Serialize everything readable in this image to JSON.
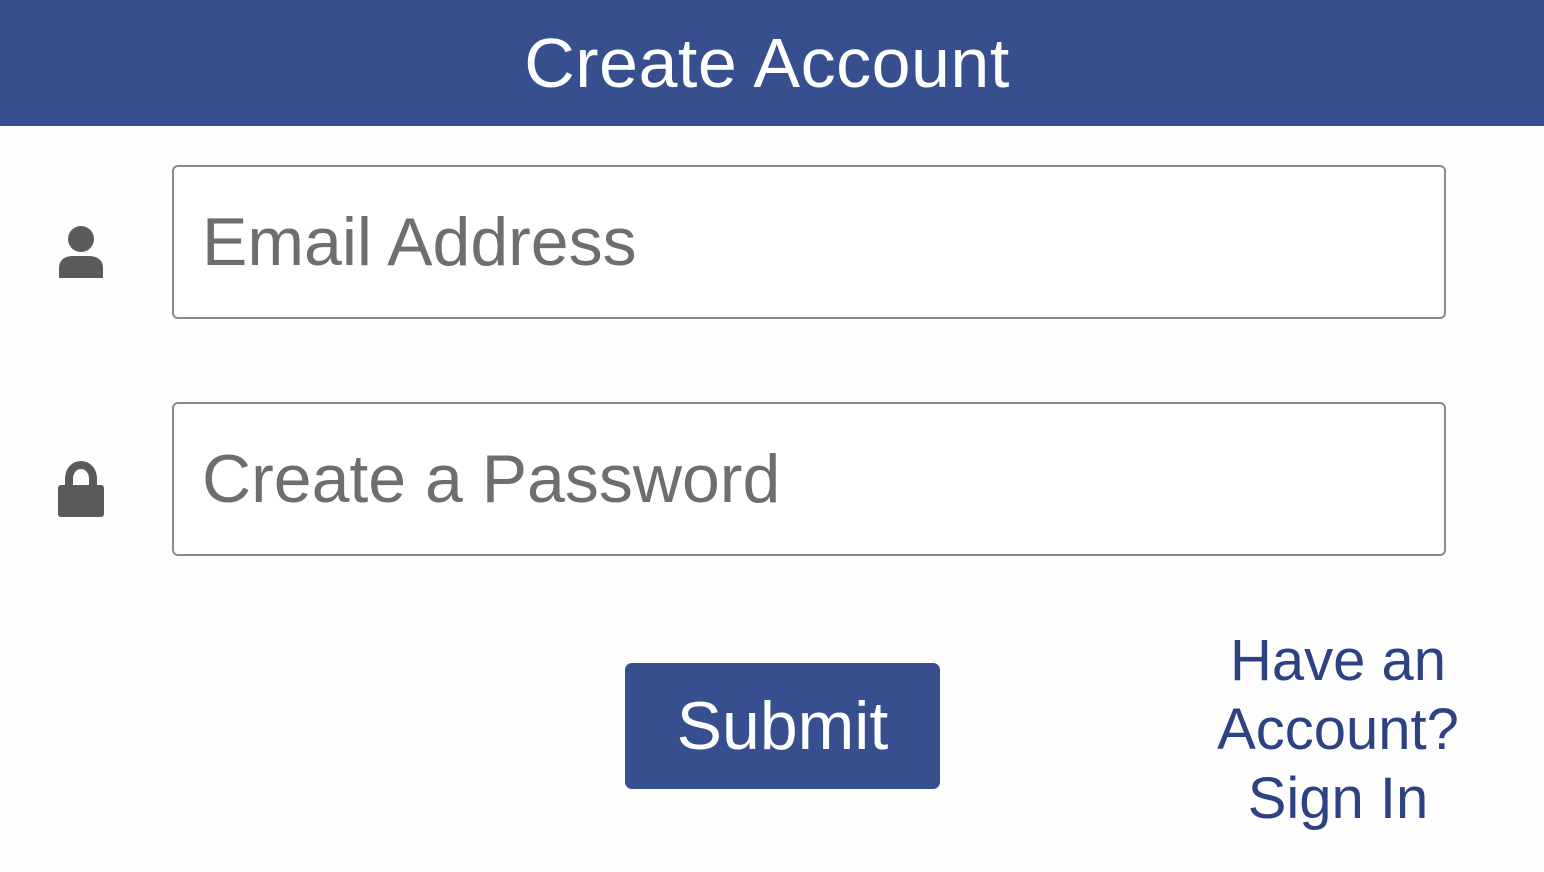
{
  "header": {
    "title": "Create Account"
  },
  "form": {
    "email": {
      "icon": "user-icon",
      "placeholder": "Email Address",
      "value": ""
    },
    "password": {
      "icon": "lock-icon",
      "placeholder": "Create a Password",
      "value": ""
    },
    "submit_label": "Submit"
  },
  "signin": {
    "line1": "Have an",
    "line2": "Account?",
    "line3": "Sign In"
  },
  "colors": {
    "brand": "#374f8f",
    "link": "#2d4282",
    "icon": "#5a5a5a",
    "placeholder": "#6e6e6e"
  }
}
